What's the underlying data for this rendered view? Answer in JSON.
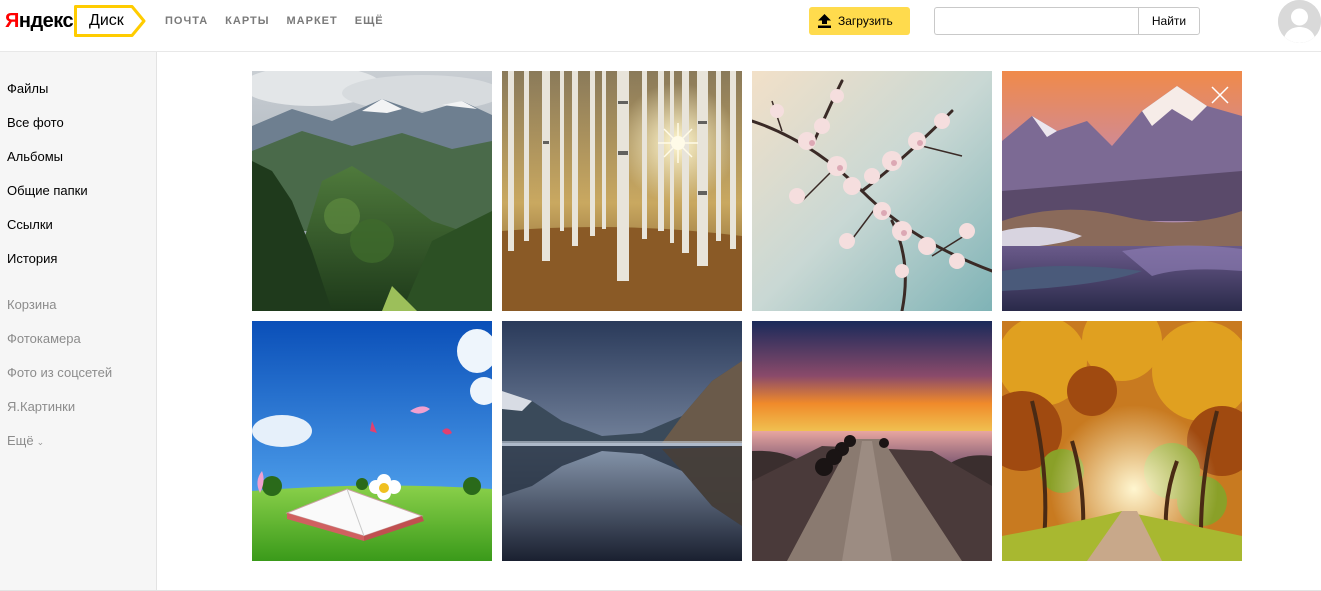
{
  "header": {
    "logo": {
      "first": "Я",
      "rest": "ндекс"
    },
    "service": "Диск",
    "nav": [
      "ПОЧТА",
      "КАРТЫ",
      "МАРКЕТ",
      "ЕЩЁ"
    ],
    "upload_label": "Загрузить",
    "search": {
      "value": "",
      "placeholder": ""
    },
    "search_button": "Найти",
    "accent_color": "#ffdb4d",
    "badge_color": "#ffcc00"
  },
  "sidebar": {
    "items": [
      "Файлы",
      "Все фото",
      "Альбомы",
      "Общие папки",
      "Ссылки",
      "История"
    ],
    "secondary": [
      "Корзина",
      "Фотокамера",
      "Фото из соцсетей",
      "Я.Картинки",
      "Ещё"
    ]
  },
  "gallery": {
    "photos": [
      "mountain-valley",
      "birch-forest",
      "cherry-blossom",
      "snowy-mountain-lake",
      "book-meadow",
      "lake-reflection",
      "sunset-pier",
      "autumn-path"
    ]
  }
}
